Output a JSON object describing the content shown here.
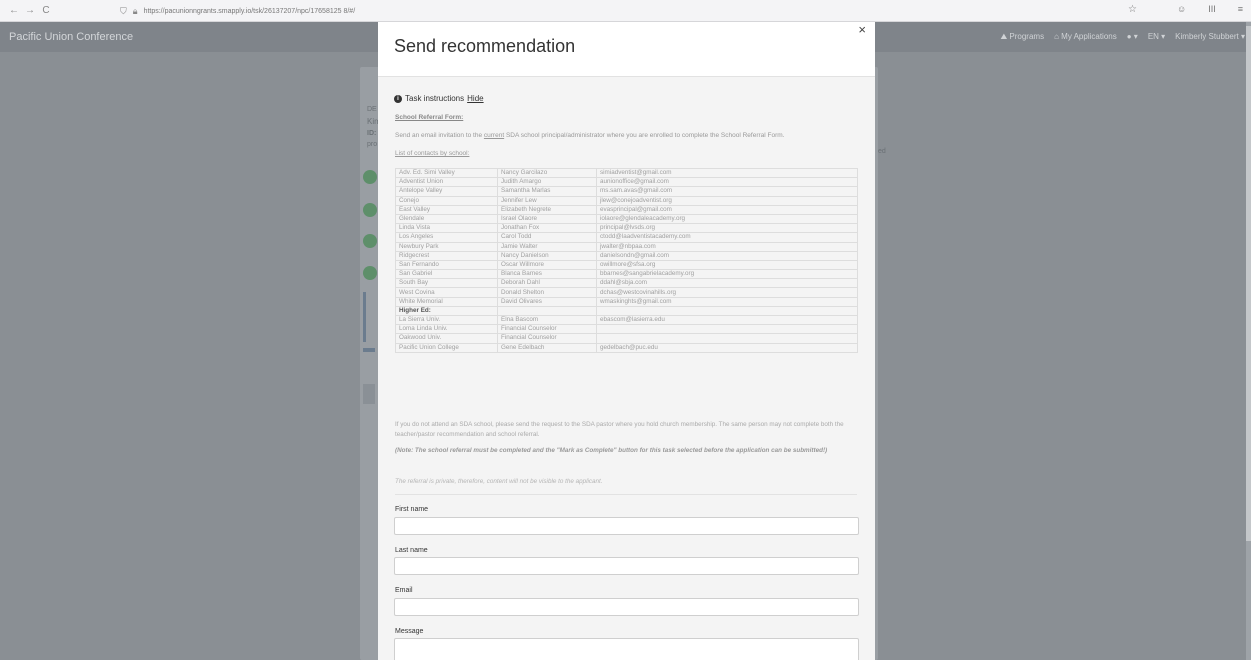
{
  "browser": {
    "url": "https://pacunionngrants.smapply.io/tsk/26137207/npc/17658125 8/#/",
    "nav_back": "←",
    "nav_forward": "→",
    "nav_reload": "C",
    "right_icons": [
      "☺",
      "III",
      "≡"
    ],
    "star": "☆"
  },
  "app": {
    "title": "Pacific Union Conference",
    "nav": [
      "⛰ Programs",
      "⌂ My Applications",
      "● ▾",
      "EN ▾",
      "Kimberly Stubbert ▾"
    ]
  },
  "background": {
    "snippets": [
      "DE",
      "Kim",
      "ID:",
      "pro",
      "ed"
    ]
  },
  "modal": {
    "title": "Send recommendation",
    "close": "×",
    "instructions_label": "Task instructions",
    "hide_link": "Hide",
    "form_heading": "School Referral Form:",
    "intro_before": "Send an email invitation to the",
    "intro_current": "current",
    "intro_after": "SDA school principal/administrator where you are enrolled to complete the School Referral Form.",
    "contacts_heading": "List of contacts by school:",
    "contacts": [
      {
        "school": "Adv. Ed. Simi Valley",
        "name": "Nancy Garcilazo",
        "email": "simiadventist@gmail.com"
      },
      {
        "school": "Adventist Union",
        "name": "Judith Amargo",
        "email": "aunionoffice@gmail.com"
      },
      {
        "school": "Antelope Valley",
        "name": "Samantha Marlas",
        "email": "ms.sam.avas@gmail.com"
      },
      {
        "school": "Conejo",
        "name": "Jennifer Lew",
        "email": "jlew@conejoadventist.org"
      },
      {
        "school": "East Valley",
        "name": "Elizabeth Negrete",
        "email": "evasprincipal@gmail.com"
      },
      {
        "school": "Glendale",
        "name": "Israel Olaore",
        "email": "iolaore@glendaleacademy.org"
      },
      {
        "school": "Linda Vista",
        "name": "Jonathan Fox",
        "email": "principal@lvsds.org"
      },
      {
        "school": "Los Angeles",
        "name": "Carol Todd",
        "email": "ctodd@laadventistacademy.com"
      },
      {
        "school": "Newbury Park",
        "name": "Jamie Walter",
        "email": "jwalter@nbpaa.com"
      },
      {
        "school": "Ridgecrest",
        "name": "Nancy Danielson",
        "email": "danielsondn@gmail.com"
      },
      {
        "school": "San Fernando",
        "name": "Oscar Willmore",
        "email": "owillmore@sfsa.org"
      },
      {
        "school": "San Gabriel",
        "name": "Blanca Barnes",
        "email": "bbarnes@sangabrielacademy.org"
      },
      {
        "school": "South Bay",
        "name": "Deborah Dahl",
        "email": "ddahl@sbja.com"
      },
      {
        "school": "West Covina",
        "name": "Donald Shelton",
        "email": "dchas@westcovinahills.org"
      },
      {
        "school": "White Memorial",
        "name": "David Olivares",
        "email": "wmaskinghts@gmail.com"
      },
      {
        "school": "Higher Ed:",
        "name": "",
        "email": "",
        "section": true
      },
      {
        "school": "La Sierra Univ.",
        "name": "Elna Bascom",
        "email": "ebascom@lasierra.edu"
      },
      {
        "school": "Loma Linda Univ.",
        "name": "Financial Counselor",
        "email": ""
      },
      {
        "school": "Oakwood Univ.",
        "name": "Financial Counselor",
        "email": ""
      },
      {
        "school": "Pacific Union College",
        "name": "Gene Edelbach",
        "email": "gedelbach@puc.edu"
      }
    ],
    "para1": "If you do not attend an SDA school, please send the request to the SDA pastor where you hold church membership. The same person may not complete both the teacher/pastor recommendation and school referral.",
    "note": "(Note: The school referral must be completed and the \"Mark as Complete\" button for this task selected before the application can be submitted!)",
    "private_note": "The referral is private, therefore, content will not be visible to the applicant.",
    "fields": {
      "first_name_label": "First name",
      "first_name_value": "",
      "last_name_label": "Last name",
      "last_name_value": "",
      "email_label": "Email",
      "email_value": "",
      "message_label": "Message",
      "message_value": ""
    }
  }
}
